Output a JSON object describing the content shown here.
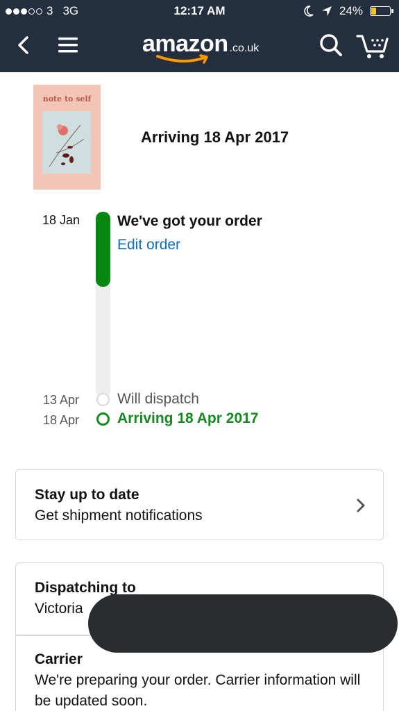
{
  "status_bar": {
    "carrier": "3",
    "network": "3G",
    "time": "12:17 AM",
    "battery": "24%",
    "battery_level": 0.24
  },
  "header": {
    "logo_text": "amazon",
    "logo_suffix": ".co.uk",
    "back_icon": "chevron-left-icon",
    "menu_icon": "hamburger-icon",
    "search_icon": "search-icon",
    "cart_icon": "cart-icon",
    "background_color": "#232f3e",
    "smile_color": "#ff9900"
  },
  "product": {
    "book_title": "note to self",
    "arriving": "Arriving 18 Apr 2017"
  },
  "timeline": {
    "ordered_date": "18 Jan",
    "ordered_title": "We've got your order",
    "edit_link": "Edit order",
    "dispatch_date": "13 Apr",
    "dispatch_label": "Will dispatch",
    "arrive_date": "18 Apr",
    "arrive_label": "Arriving 18 Apr 2017",
    "progress_color": "#06870f",
    "link_color": "#0b6cbd"
  },
  "notifications_card": {
    "title": "Stay up to date",
    "text": "Get shipment notifications"
  },
  "shipping_card": {
    "dispatch_title": "Dispatching to",
    "recipient": "Victoria",
    "carrier_title": "Carrier",
    "carrier_text": "We're preparing your order. Carrier information will be updated soon."
  }
}
